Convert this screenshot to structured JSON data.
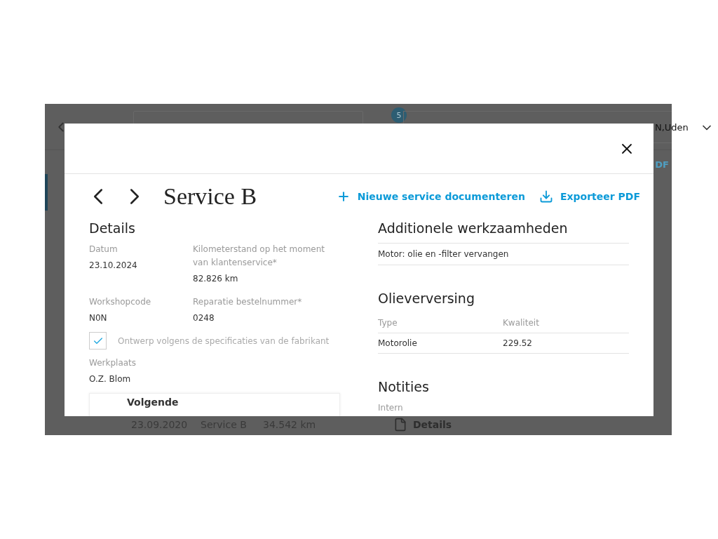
{
  "background_app": {
    "badge": "5",
    "location": "N,Uden",
    "partial_link": "DF",
    "history_row": {
      "date": "23.09.2020",
      "service": "Service B",
      "mileage": "34.542 km",
      "document": "Details"
    }
  },
  "modal": {
    "title": "Service B",
    "actions": [
      {
        "kind": "add",
        "label": "Nieuwe service documenteren"
      },
      {
        "kind": "export",
        "label": "Exporteer PDF"
      }
    ],
    "details": {
      "heading": "Details",
      "fields": [
        {
          "label": "Datum",
          "value": "23.10.2024"
        },
        {
          "label": "Kilometerstand op het moment van klantenservice*",
          "value": "82.826 km"
        },
        {
          "label": "Workshopcode",
          "value": "N0N"
        },
        {
          "label": "Reparatie bestelnummer*",
          "value": "0248"
        }
      ],
      "checkbox": {
        "label": "Ontwerp volgens de specificaties van de fabrikant",
        "checked": true
      },
      "workshop": {
        "label": "Werkplaats",
        "value": "O.Z. Blom"
      }
    },
    "next_card": {
      "title": "Volgende"
    },
    "additional_work": {
      "heading": "Additionele werkzaamheden",
      "items": [
        "Motor: olie en -filter vervangen"
      ]
    },
    "oil_change": {
      "heading": "Olieverversing",
      "columns": [
        "Type",
        "Kwaliteit"
      ],
      "rows": [
        [
          "Motorolie",
          "229.52"
        ]
      ]
    },
    "notes": {
      "heading": "Notities",
      "label": "Intern"
    }
  }
}
